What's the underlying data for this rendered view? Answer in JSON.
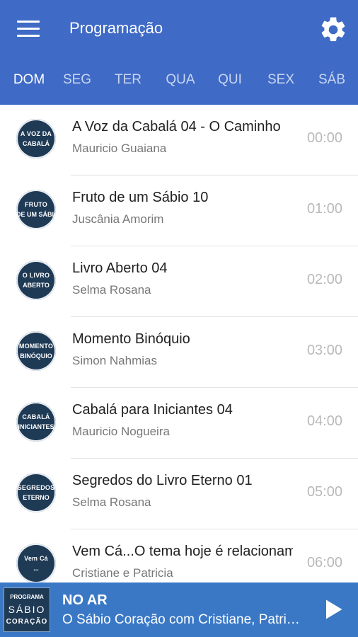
{
  "header": {
    "title": "Programação"
  },
  "tabs": [
    {
      "label": "DOM",
      "active": true
    },
    {
      "label": "SEG"
    },
    {
      "label": "TER"
    },
    {
      "label": "QUA"
    },
    {
      "label": "QUI"
    },
    {
      "label": "SEX"
    },
    {
      "label": "SÁB"
    }
  ],
  "schedule": [
    {
      "title": "A Voz da Cabalá 04 - O Caminho",
      "host": "Mauricio Guaiana",
      "time": "00:00",
      "logo": [
        "A VOZ DA",
        "CABALÁ"
      ]
    },
    {
      "title": "Fruto de um Sábio 10",
      "host": "Juscânia Amorim",
      "time": "01:00",
      "logo": [
        "FRUTO",
        "DE UM SÁBIO"
      ]
    },
    {
      "title": "Livro Aberto 04",
      "host": "Selma Rosana",
      "time": "02:00",
      "logo": [
        "O LIVRO",
        "ABERTO"
      ]
    },
    {
      "title": "Momento Binóquio",
      "host": "Simon Nahmias",
      "time": "03:00",
      "logo": [
        "MOMENTO",
        "BINÓQUIO"
      ]
    },
    {
      "title": "Cabalá para Iniciantes 04",
      "host": "Mauricio Nogueira",
      "time": "04:00",
      "logo": [
        "CABALÁ",
        "INICIANTES"
      ]
    },
    {
      "title": "Segredos do Livro Eterno 01",
      "host": "Selma Rosana",
      "time": "05:00",
      "logo": [
        "SEGREDOS",
        "ETERNO"
      ]
    },
    {
      "title": "Vem Cá...O tema hoje é relacionamento",
      "host": "Cristiane e Patricia",
      "time": "06:00",
      "logo": [
        "Vem Cá",
        "..."
      ]
    }
  ],
  "player": {
    "label": "NO AR",
    "now_playing": "O Sábio Coração com Cristiane, Patricia",
    "thumb": [
      "PROGRAMA",
      "SÁBIO",
      "CORAÇÃO"
    ]
  },
  "colors": {
    "appbar": "#3f6ac5",
    "player": "#3a78c6",
    "logo_bg": "#1f3a55"
  }
}
